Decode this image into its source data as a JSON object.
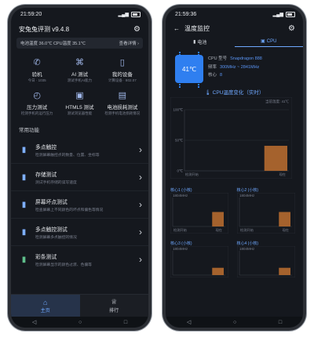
{
  "left": {
    "status": {
      "time": "21:59:20"
    },
    "app_title": "安兔兔评测 v9.4.8",
    "info_left": "电池温度 36.0℃  CPU温度 35.1℃",
    "info_right": "查看详情 ›",
    "features": [
      {
        "icon": "phone-icon",
        "glyph": "✆",
        "label": "验机",
        "sub": "今日 · 1035"
      },
      {
        "icon": "ai-icon",
        "glyph": "⌘",
        "label": "AI 测试",
        "sub": "测试手机AI能力"
      },
      {
        "icon": "device-icon",
        "glyph": "▯",
        "label": "我的设备",
        "sub": "计算设备 · 802.07"
      },
      {
        "icon": "stress-icon",
        "glyph": "◴",
        "label": "压力测试",
        "sub": "检测手机的运行压力"
      },
      {
        "icon": "html5-icon",
        "glyph": "▣",
        "label": "HTML5 测试",
        "sub": "测试浏览器性能"
      },
      {
        "icon": "battery-icon",
        "glyph": "▤",
        "label": "电池损耗测试",
        "sub": "检测手机电池损耗情况"
      }
    ],
    "section_title": "常用功能",
    "list": [
      {
        "icon": "multitouch-icon",
        "glyph": "▮",
        "title": "多点触控",
        "sub": "检测屏幕触控点的数量、位置、坐标等"
      },
      {
        "icon": "storage-icon",
        "glyph": "▮",
        "title": "存储测试",
        "sub": "测试手机存储的读写速度"
      },
      {
        "icon": "screen-icon",
        "glyph": "▮",
        "title": "屏幕坏点测试",
        "sub": "检查屏幕上不同颜色的坏点和偏色等情况"
      },
      {
        "icon": "multitouch-test-icon",
        "glyph": "▮",
        "title": "多点触控测试",
        "sub": "检测屏幕多点触控的情况"
      },
      {
        "icon": "color-icon",
        "glyph": "▮",
        "title": "彩条测试",
        "sub": "检测屏幕显示的颜色过渡、色偏等"
      }
    ],
    "tabs": [
      {
        "icon": "home-icon",
        "glyph": "⌂",
        "label": "主页",
        "active": true
      },
      {
        "icon": "rank-icon",
        "glyph": "♕",
        "label": "排行",
        "active": false
      }
    ]
  },
  "right": {
    "status": {
      "time": "21:59:36"
    },
    "title": "温度监控",
    "tabs": [
      {
        "icon": "battery-tab-icon",
        "glyph": "▮",
        "label": "电池",
        "active": false
      },
      {
        "icon": "cpu-tab-icon",
        "glyph": "▣",
        "label": "CPU",
        "active": true
      }
    ],
    "chip_temp": "41℃",
    "cpu_info": [
      {
        "k": "CPU 型号",
        "v": "Snapdragon 888"
      },
      {
        "k": "频率",
        "v": "300MHz ~ 2841MHz"
      },
      {
        "k": "核心",
        "v": "8"
      }
    ],
    "chart_title": "CPU温度变化（实时）",
    "accent": "#6fa8ff",
    "bar_color": "#a5622d"
  },
  "chart_data": [
    {
      "type": "bar",
      "title": "CPU温度变化（实时）",
      "subtitle": "当前温度: 41℃",
      "y_ticks": [
        "100℃",
        "50℃",
        "0℃"
      ],
      "ylim": [
        0,
        100
      ],
      "x_labels": [
        "检测开始",
        "现在"
      ],
      "values": [
        41
      ]
    },
    {
      "type": "bar",
      "title": "核心1 (小核)",
      "subtitle": "1804MHz",
      "x_labels": [
        "检测开始",
        "现在"
      ],
      "values": [
        0.5
      ]
    },
    {
      "type": "bar",
      "title": "核心2 (小核)",
      "subtitle": "1804MHz",
      "x_labels": [
        "检测开始",
        "现在"
      ],
      "values": [
        0.5
      ]
    },
    {
      "type": "bar",
      "title": "核心3 (小核)",
      "subtitle": "1804MHz",
      "x_labels": [
        "",
        ""
      ],
      "values": [
        0.3
      ]
    },
    {
      "type": "bar",
      "title": "核心4 (小核)",
      "subtitle": "1804MHz",
      "x_labels": [
        "",
        ""
      ],
      "values": [
        0.3
      ]
    }
  ]
}
